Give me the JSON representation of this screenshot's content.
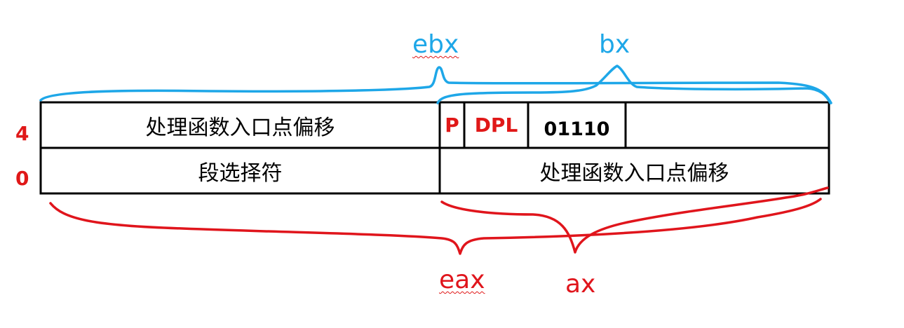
{
  "registers": {
    "ebx": "ebx",
    "bx": "bx",
    "eax": "eax",
    "ax": "ax"
  },
  "rows": [
    {
      "index": "4",
      "left": "处理函数入口点偏移",
      "right": {
        "p": "P",
        "dpl": "DPL",
        "type": "01110",
        "rest": ""
      }
    },
    {
      "index": "0",
      "left": "段选择符",
      "right_text": "处理函数入口点偏移"
    }
  ],
  "colors": {
    "top_brace": "#1ea7e8",
    "bottom_brace": "#e0151c",
    "row_index": "#e01818",
    "flag_text": "#e01818",
    "grid": "#000000"
  }
}
